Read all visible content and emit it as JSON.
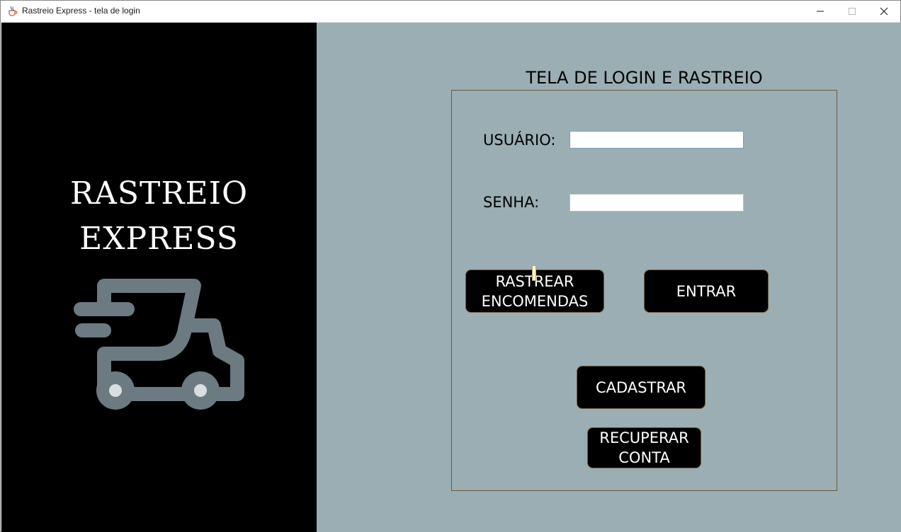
{
  "window": {
    "title": "Rastreio Express - tela de login",
    "controls": [
      "minimize",
      "maximize",
      "close"
    ]
  },
  "brand": {
    "line1": "RASTREIO",
    "line2": "EXPRESS",
    "logo_icon": "delivery-truck-icon",
    "logo_color": "#6b7b81"
  },
  "login": {
    "heading": "TELA DE LOGIN E RASTREIO",
    "username_label": "USUÁRIO:",
    "username_value": "",
    "password_label": "SENHA:",
    "password_value": "",
    "buttons": {
      "track": "RASTREAR\nENCOMENDAS",
      "enter": "ENTRAR",
      "register": "CADASTRAR",
      "recover": "RECUPERAR\nCONTA"
    }
  },
  "colors": {
    "left_panel": "#000000",
    "right_panel": "#9baeb4",
    "button_bg": "#000000",
    "button_text": "#ffffff",
    "box_border": "#6b5a3a"
  }
}
